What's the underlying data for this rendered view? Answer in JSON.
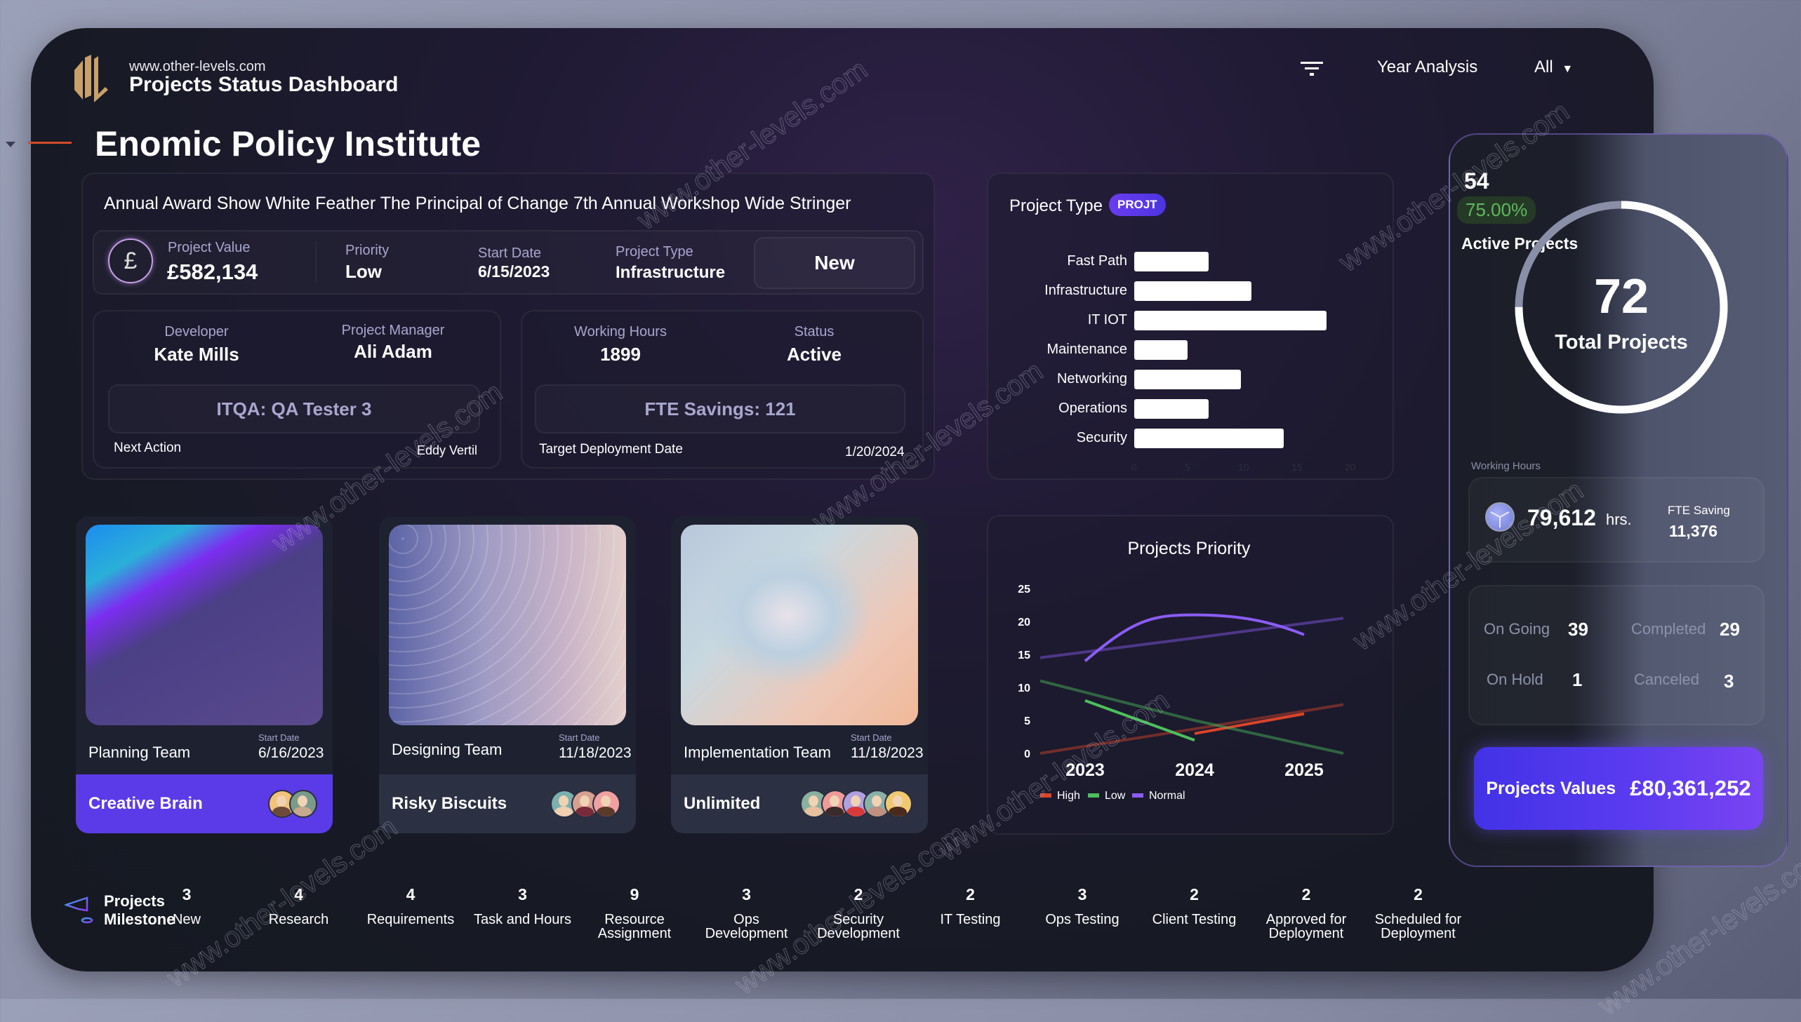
{
  "header": {
    "site": "www.other-levels.com",
    "title": "Projects Status Dashboard",
    "filter_icon": "filter-icon",
    "year_label": "Year Analysis",
    "year_value": "All",
    "org_title": "Enomic Policy Institute"
  },
  "project": {
    "name": "Annual Award Show White Feather The Principal of Change 7th Annual Workshop Wide Stringer",
    "value_icon": "pound-icon",
    "value_label": "Project Value",
    "value": "£582,134",
    "priority_label": "Priority",
    "priority": "Low",
    "start_label": "Start Date",
    "start": "6/15/2023",
    "type_label": "Project Type",
    "type": "Infrastructure",
    "stage": "New",
    "developer_label": "Developer",
    "developer": "Kate Mills",
    "pm_label": "Project Manager",
    "pm": "Ali Adam",
    "itqa": "ITQA: QA Tester 3",
    "next_action_label": "Next Action",
    "next_action": "Eddy Vertil",
    "hours_label": "Working Hours",
    "hours": "1899",
    "status_label": "Status",
    "status": "Active",
    "fte": "FTE Savings:  121",
    "target_label": "Target Deployment Date",
    "target": "1/20/2024"
  },
  "chart_data": [
    {
      "type": "bar",
      "orientation": "horizontal",
      "title": "Project Type",
      "badge": "PROJT",
      "categories": [
        "Fast Path",
        "Infrastructure",
        "IT IOT",
        "Maintenance",
        "Networking",
        "Operations",
        "Security"
      ],
      "values": [
        7,
        11,
        18,
        5,
        10,
        7,
        14
      ],
      "xticks": [
        "0",
        "5",
        "10",
        "15",
        "20"
      ],
      "xlim": [
        0,
        20
      ],
      "bar_color": "#ffffff"
    },
    {
      "type": "line",
      "title": "Projects Priority",
      "categories": [
        "2023",
        "2024",
        "2025"
      ],
      "yticks": [
        "0",
        "5",
        "10",
        "15",
        "20",
        "25"
      ],
      "ylim": [
        0,
        25
      ],
      "series": [
        {
          "name": "High",
          "color": "#d9442a",
          "values": [
            null,
            3,
            6
          ],
          "trend": [
            0,
            3.7,
            7.4
          ]
        },
        {
          "name": "Low",
          "color": "#4cbf5c",
          "values": [
            8,
            2,
            null
          ],
          "trend": [
            11,
            5,
            -1
          ]
        },
        {
          "name": "Normal",
          "color": "#8b5cf6",
          "values": [
            14,
            21,
            18
          ],
          "trend": [
            14.5,
            17.5,
            20.5
          ]
        }
      ],
      "legend": "bottom"
    }
  ],
  "teams": [
    {
      "team": "Planning Team",
      "start_label": "Start Date",
      "start": "6/16/2023",
      "name": "Creative Brain",
      "members": 2
    },
    {
      "team": "Designing Team",
      "start_label": "Start Date",
      "start": "11/18/2023",
      "name": "Risky Biscuits",
      "members": 3
    },
    {
      "team": "Implementation Team",
      "start_label": "Start Date",
      "start": "11/18/2023",
      "name": "Unlimited",
      "members": 5
    }
  ],
  "kpi": {
    "active_count": "54",
    "active_pct": "75.00%",
    "active_label": "Active Projects",
    "active_fraction": 0.75,
    "total": "72",
    "total_label": "Total Projects",
    "working_hours_label": "Working Hours",
    "working_hours": "79,612",
    "hours_unit": "hrs.",
    "fte_label": "FTE Saving",
    "fte": "11,376",
    "statuses": [
      {
        "label": "On Going",
        "value": "39"
      },
      {
        "label": "Completed",
        "value": "29"
      },
      {
        "label": "On Hold",
        "value": "1"
      },
      {
        "label": "Canceled",
        "value": "3"
      }
    ],
    "projects_values_label": "Projects Values",
    "projects_values": "£80,361,252"
  },
  "milestone": {
    "title_line1": "Projects",
    "title_line2": "Milestone",
    "items": [
      {
        "count": "3",
        "label": "New"
      },
      {
        "count": "4",
        "label": "Research"
      },
      {
        "count": "4",
        "label": "Requirements"
      },
      {
        "count": "3",
        "label": "Task and Hours"
      },
      {
        "count": "9",
        "label": "Resource Assignment"
      },
      {
        "count": "3",
        "label": "Ops Development"
      },
      {
        "count": "2",
        "label": "Security Development"
      },
      {
        "count": "2",
        "label": "IT Testing"
      },
      {
        "count": "3",
        "label": "Ops Testing"
      },
      {
        "count": "2",
        "label": "Client Testing"
      },
      {
        "count": "2",
        "label": "Approved for Deployment"
      },
      {
        "count": "2",
        "label": "Scheduled for Deployment"
      }
    ]
  },
  "watermark": "www.other-levels.com"
}
